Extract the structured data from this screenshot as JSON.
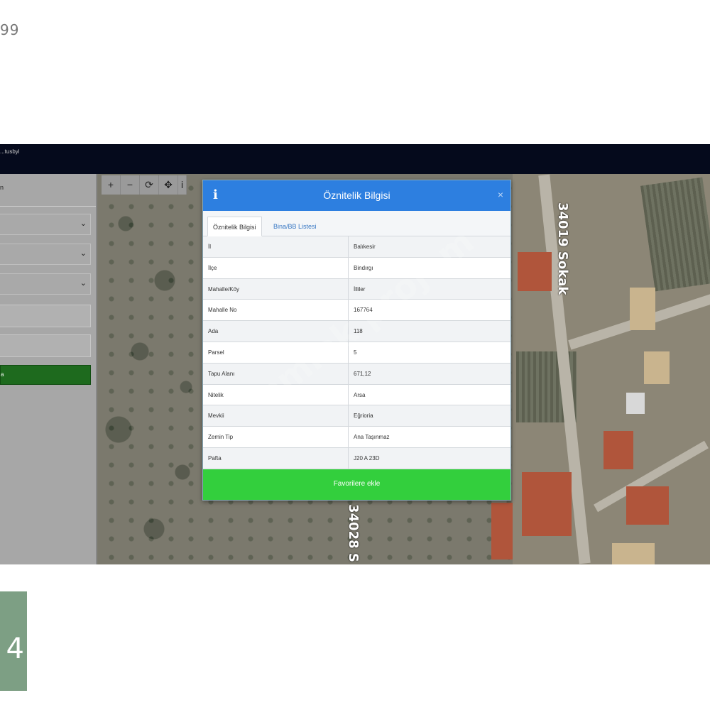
{
  "page": {
    "corner_number": "99",
    "corner_logo_glyph": "4"
  },
  "app": {
    "title": "...tusbyi",
    "sidebar_title": "n"
  },
  "sidebar": {
    "selects": [
      "",
      "",
      ""
    ],
    "inputs": [
      "",
      ""
    ],
    "button_label": "a"
  },
  "map": {
    "street_label_1": "34019 Sokak",
    "street_label_2": "34028 S",
    "tools": [
      "+",
      "−",
      "⟳",
      "✥",
      "i"
    ]
  },
  "dialog": {
    "title": "Öznitelik Bilgisi",
    "close": "×",
    "tabs": {
      "active": "Öznitelik Bilgisi",
      "inactive": "Bina/BB Listesi"
    },
    "rows": [
      {
        "key": "İl",
        "value": "Balıkesir"
      },
      {
        "key": "İlçe",
        "value": "Bindırgı"
      },
      {
        "key": "Mahalle/Köy",
        "value": "İlliler"
      },
      {
        "key": "Mahalle No",
        "value": "167764"
      },
      {
        "key": "Ada",
        "value": "118"
      },
      {
        "key": "Parsel",
        "value": "5"
      },
      {
        "key": "Tapu Alanı",
        "value": "671,12"
      },
      {
        "key": "Nitelik",
        "value": "Arsa"
      },
      {
        "key": "Mevkii",
        "value": "Eğrioria"
      },
      {
        "key": "Zemin Tip",
        "value": "Ana Taşınmaz"
      },
      {
        "key": "Pafta",
        "value": "J20 A 23D"
      }
    ],
    "favorite_button": "Favorilere ekle"
  },
  "watermark": "emlak projem"
}
